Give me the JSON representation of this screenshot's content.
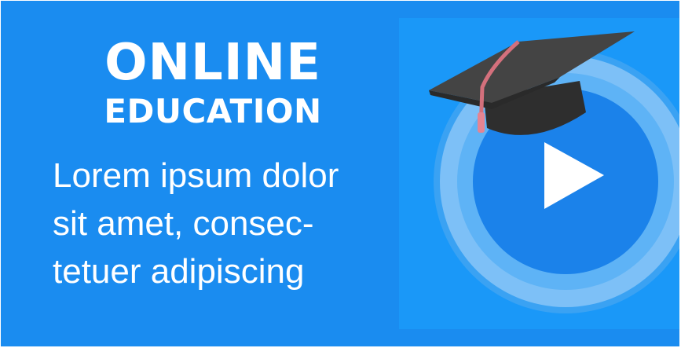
{
  "headline": {
    "line1": "ONLINE",
    "line2": "EDUCATION"
  },
  "body": {
    "lines": [
      "Lorem ipsum dolor",
      "sit amet, consec-",
      "tetuer adipiscing"
    ]
  },
  "colors": {
    "background": "#1a8cf0",
    "panel": "#1a98f8",
    "ring_outer": "#4aaaf5",
    "ring_inner": "#8ec9f8",
    "circle": "#1b82ea",
    "play": "#ffffff",
    "cap": "#3a3a3a",
    "tassel": "#e07a8a"
  },
  "icons": {
    "play": "play-icon",
    "cap": "graduation-cap-icon"
  }
}
